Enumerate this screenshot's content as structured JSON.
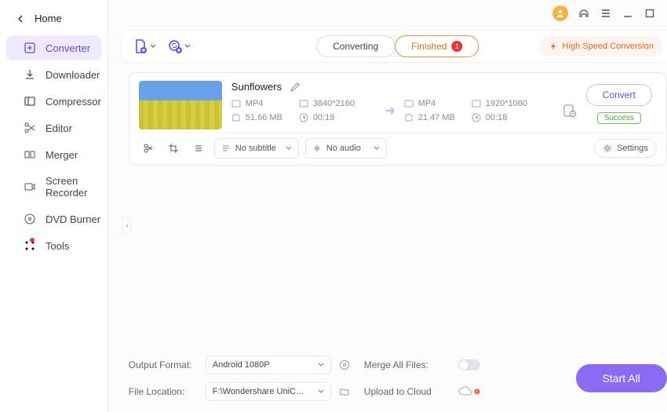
{
  "sidebar": {
    "home": "Home",
    "items": [
      {
        "label": "Converter"
      },
      {
        "label": "Downloader"
      },
      {
        "label": "Compressor"
      },
      {
        "label": "Editor"
      },
      {
        "label": "Merger"
      },
      {
        "label": "Screen Recorder"
      },
      {
        "label": "DVD Burner"
      },
      {
        "label": "Tools"
      }
    ]
  },
  "toolbar": {
    "tabs": {
      "converting": "Converting",
      "finished": "Finished",
      "finished_count": "1"
    },
    "high_speed": "High Speed Conversion"
  },
  "file": {
    "title": "Sunflowers",
    "src": {
      "format": "MP4",
      "resolution": "3840*2160",
      "size": "51.66 MB",
      "duration": "00:18"
    },
    "dst": {
      "format": "MP4",
      "resolution": "1920*1080",
      "size": "21.47 MB",
      "duration": "00:18"
    },
    "subtitle": "No subtitle",
    "audio": "No audio",
    "settings_label": "Settings",
    "convert_label": "Convert",
    "status": "Success"
  },
  "footer": {
    "output_format_label": "Output Format:",
    "output_format_value": "Android 1080P",
    "file_location_label": "File Location:",
    "file_location_value": "F:\\Wondershare UniConverter 1",
    "merge_label": "Merge All Files:",
    "upload_label": "Upload to Cloud",
    "start_all": "Start All"
  }
}
